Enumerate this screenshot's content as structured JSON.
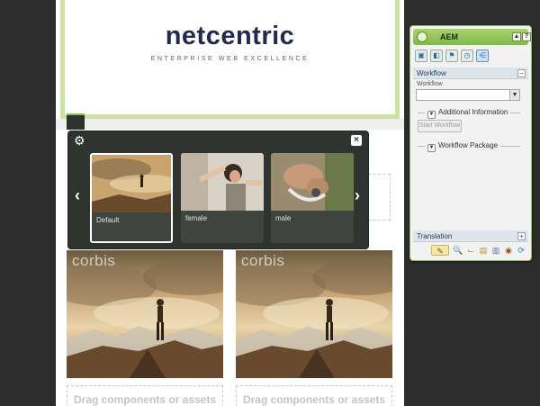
{
  "header": {
    "logo_text": "netcentric",
    "logo_tagline": "ENTERPRISE WEB EXCELLENCE"
  },
  "picker": {
    "thumbnails": [
      {
        "label": "Default",
        "selected": true
      },
      {
        "label": "female",
        "selected": false
      },
      {
        "label": "male",
        "selected": false
      }
    ],
    "close_label": "×",
    "prev_label": "‹",
    "next_label": "›"
  },
  "content": {
    "watermark": "corbis",
    "drop_zone_text": "Drag components or assets here"
  },
  "sidekick": {
    "title": "AEM",
    "minimize_label": "▲",
    "help_label": "?",
    "tabs": [
      "components-icon",
      "pages-icon",
      "workflow-icon",
      "versioning-icon",
      "info-icon"
    ],
    "workflow_section": "Workflow",
    "workflow_collapse": "−",
    "workflow_field_label": "Workflow",
    "workflow_select_value": "",
    "additional_information": "Additional Information",
    "start_workflow": "Start Workflow",
    "workflow_package": "Workflow Package",
    "translation_section": "Translation",
    "translation_expand": "+",
    "accent_color": "#8bc34a"
  }
}
